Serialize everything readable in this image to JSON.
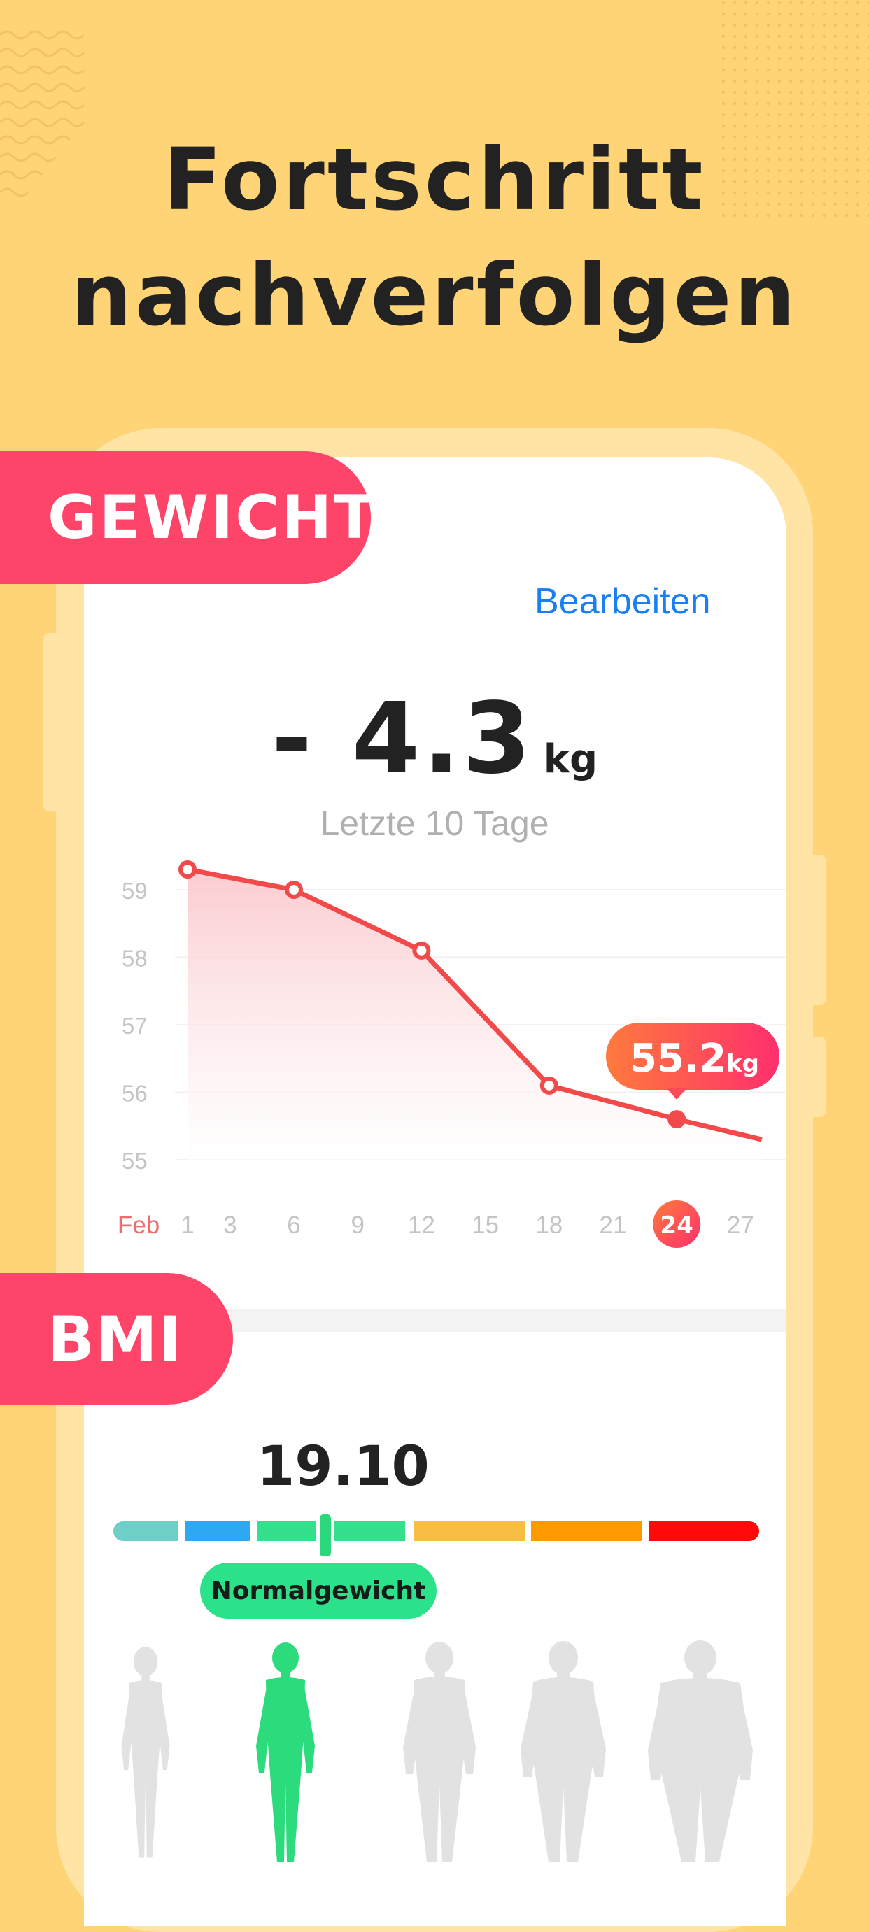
{
  "headline": [
    "Fortschritt",
    "nachverfolgen"
  ],
  "weight_section": {
    "title": "GEWICHT",
    "edit_label": "Bearbeiten",
    "change_value": "- 4.3",
    "change_unit": "kg",
    "period_label": "Letzte 10 Tage"
  },
  "chart_data": {
    "type": "line",
    "title": "",
    "xlabel": "",
    "ylabel": "",
    "x_month_label": "Feb",
    "x_ticks": [
      1,
      3,
      6,
      9,
      12,
      15,
      18,
      21,
      24,
      27
    ],
    "selected_tick": 24,
    "y_ticks": [
      59,
      58,
      57,
      56,
      55
    ],
    "ylim": [
      55,
      59
    ],
    "series": [
      {
        "points": [
          {
            "x": 1,
            "y": 59.3
          },
          {
            "x": 6,
            "y": 59.0
          },
          {
            "x": 12,
            "y": 58.1
          },
          {
            "x": 18,
            "y": 56.1
          },
          {
            "x": 24,
            "y": 55.6
          },
          {
            "x": 28,
            "y": 55.3
          }
        ]
      }
    ],
    "callout": {
      "x": 24,
      "value": "55.2",
      "unit": "kg"
    },
    "colors": {
      "line": "#F24A4A",
      "fill": "#FBD3D6",
      "callout": "#FF4469",
      "month": "#F06B6B"
    }
  },
  "bmi_section": {
    "title": "BMI",
    "value": "19.10",
    "category_label": "Normalgewicht",
    "scale_colors": [
      "#6DCFC7",
      "#2EA8F2",
      "#35E08C",
      "#35E08C",
      "#F7BE45",
      "#FF9900",
      "#FF0A0A"
    ],
    "figures": [
      "underweight-figure-icon",
      "normal-figure-icon",
      "overweight-figure-icon",
      "obese-figure-icon",
      "extremely-obese-figure-icon"
    ],
    "active_figure_color": "#2BDB7C",
    "inactive_figure_color": "#E2E2E2"
  },
  "colors": {
    "background": "#FFD477",
    "accent": "#FF4469",
    "link": "#1A7EF5"
  }
}
